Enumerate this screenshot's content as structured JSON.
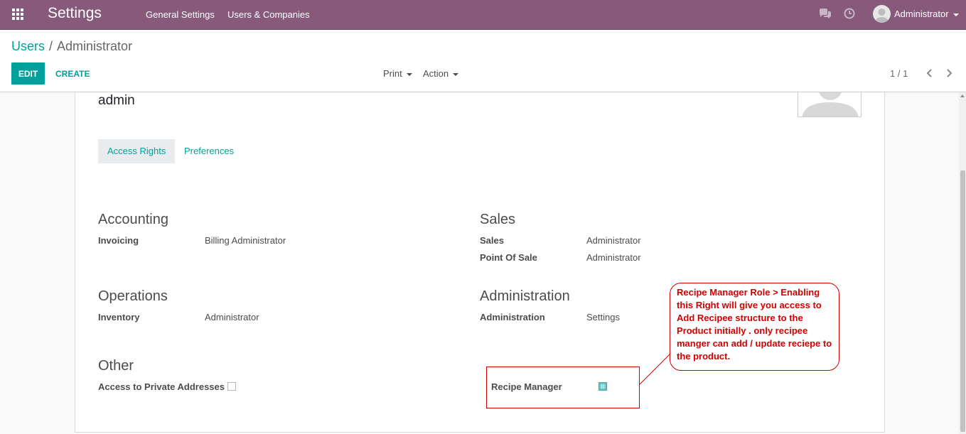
{
  "navbar": {
    "title": "Settings",
    "menu": [
      "General Settings",
      "Users & Companies"
    ],
    "user": "Administrator",
    "icons": [
      "apps-grid-icon",
      "chat-icon",
      "clock-icon",
      "user-avatar-icon"
    ]
  },
  "breadcrumb": {
    "parent": "Users",
    "separator": "/",
    "current": "Administrator"
  },
  "toolbar": {
    "edit": "EDIT",
    "create": "CREATE",
    "print": "Print",
    "action": "Action"
  },
  "pager": {
    "value": "1 / 1"
  },
  "form": {
    "login": "admin",
    "tabs": [
      "Access Rights",
      "Preferences"
    ],
    "groups": {
      "accounting": {
        "title": "Accounting",
        "fields": [
          {
            "label": "Invoicing",
            "value": "Billing Administrator"
          }
        ]
      },
      "sales": {
        "title": "Sales",
        "fields": [
          {
            "label": "Sales",
            "value": "Administrator"
          },
          {
            "label": "Point Of Sale",
            "value": "Administrator"
          }
        ]
      },
      "operations": {
        "title": "Operations",
        "fields": [
          {
            "label": "Inventory",
            "value": "Administrator"
          }
        ]
      },
      "administration": {
        "title": "Administration",
        "fields": [
          {
            "label": "Administration",
            "value": "Settings"
          }
        ]
      },
      "other": {
        "title": "Other",
        "private_addresses_label": "Access to Private Addresses",
        "private_addresses_checked": false
      },
      "recipe": {
        "label": "Recipe Manager",
        "checked": true
      }
    }
  },
  "annotation": {
    "text": "Recipe Manager Role > Enabling this Right will give you access to Add Recipee structure to the Product initially . only recipee manger can add / update reciepe to the product.",
    "color": "#cc0000"
  },
  "colors": {
    "navbar": "#875a7b",
    "accent": "#00a09d"
  }
}
